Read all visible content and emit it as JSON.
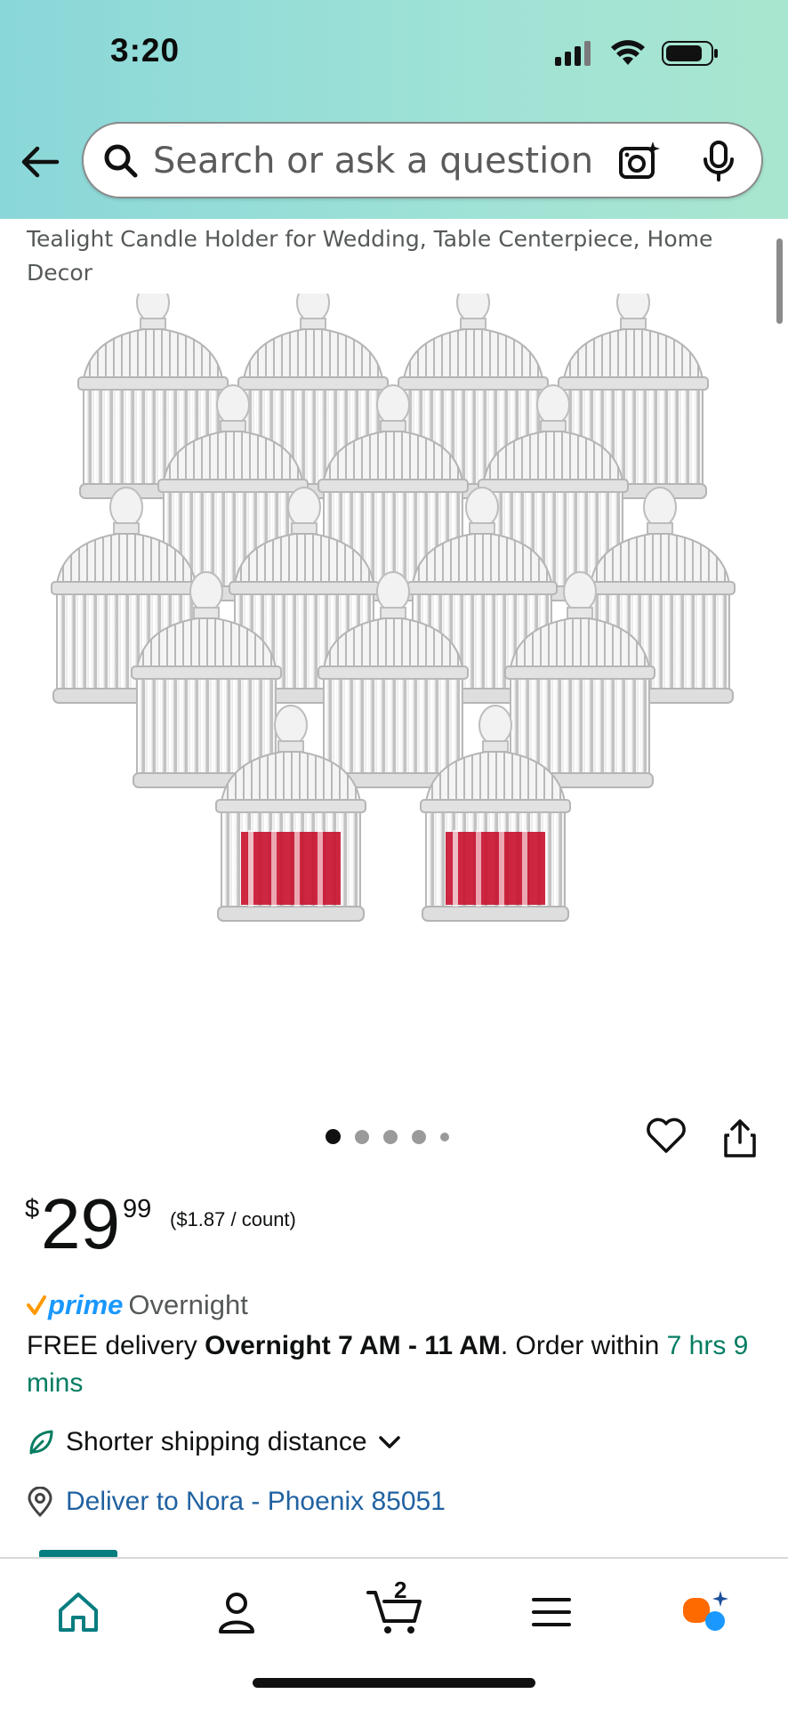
{
  "status_bar": {
    "time": "3:20"
  },
  "search": {
    "placeholder": "Search or ask a question"
  },
  "product": {
    "title": "Tealight Candle Holder for Wedding, Table Centerpiece, Home Decor",
    "image_dots": {
      "count": 5,
      "active_index": 0
    },
    "price": {
      "currency": "$",
      "whole": "29",
      "fraction": "99"
    },
    "unit_price": "($1.87 / count)"
  },
  "prime": {
    "brand": "prime",
    "tier": "Overnight"
  },
  "delivery": {
    "prefix": "FREE delivery ",
    "window": "Overnight 7 AM - 11 AM",
    "middle": ". Order within ",
    "countdown": "7 hrs 9 mins"
  },
  "shipping_note": "Shorter shipping distance",
  "deliver_to": "Deliver to Nora - Phoenix 85051",
  "bottom_nav": {
    "cart_count": "2",
    "items": [
      "home-icon",
      "account-icon",
      "cart-icon",
      "menu-icon",
      "rufus-ai-icon"
    ]
  },
  "colors": {
    "accent_teal": "#067d62",
    "link_blue": "#2162a1",
    "prime_blue": "#1a98ff"
  }
}
